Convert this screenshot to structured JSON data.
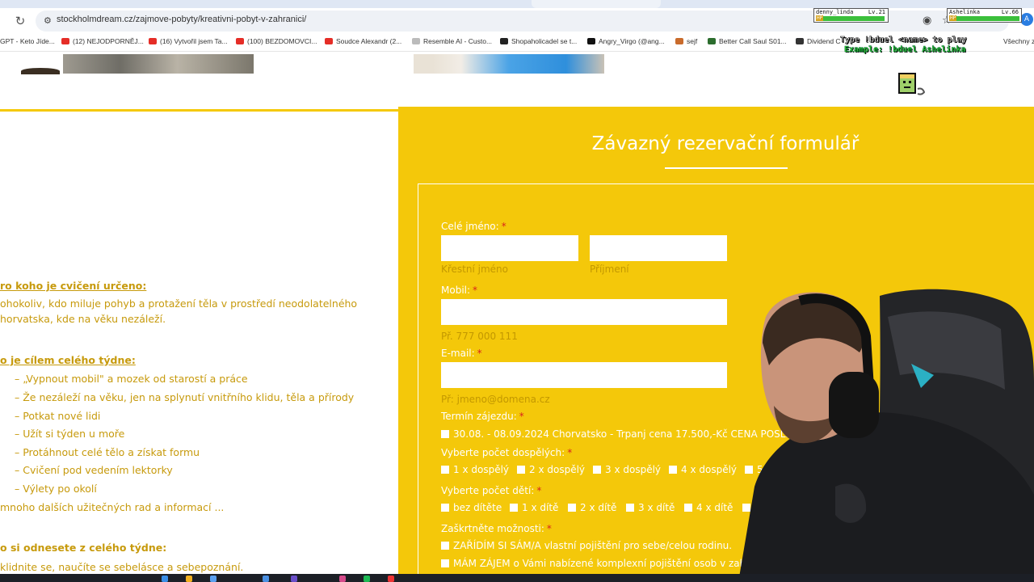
{
  "browser": {
    "url": "stockholmdream.cz/zajmove-pobyty/kreativni-pobyt-v-zahranici/",
    "avatar_letter": "A",
    "bookmarks": [
      "GPT - Keto Jíde...",
      "(12) NEJODPORNĚJ...",
      "(16) Vytvořil jsem Ta...",
      "(100) BEZDOMOVCI...",
      "Soudce Alexandr (2...",
      "Resemble AI - Custo...",
      "Shopaholicadel se t...",
      "Angry_Virgo (@ang...",
      "sejf",
      "Better Call Saul S01...",
      "Dividend C",
      "Všechny z"
    ]
  },
  "overlay": {
    "player1_name": "denny_linda",
    "player1_level": "Lv.21",
    "player1_hp": 0.95,
    "player2_name": "Ashelinka",
    "player2_level": "Lv.66",
    "player2_hp": 0.97,
    "hp_label": "HP",
    "duel_instruction": "Type !bduel <name> to play",
    "duel_example": "Example: !bduel Ashelinka"
  },
  "left": {
    "h1": "ro koho je cvičení určeno:",
    "p1a": "ohokoliv, kdo miluje pohyb a protažení těla v prostředí neodolatelného",
    "p1b": "horvatska, kde na věku nezáleží.",
    "h2": "o je cílem celého týdne:",
    "items": [
      "– „Vypnout mobil\" a mozek od starostí a práce",
      "– Že nezáleží na věku, jen na splynutí vnitřního klidu, těla a přírody",
      "– Potkat nové lidi",
      "– Užít si týden u moře",
      "– Protáhnout celé tělo a získat formu",
      "– Cvičení pod vedením lektorky",
      "– Výlety po okolí"
    ],
    "more": "mnoho dalších užitečných rad a informací ...",
    "h3": "o si odnesete z celého týdne:",
    "p3": "klidnite se, naučíte se sebelásce a sebepoznání."
  },
  "form": {
    "title": "Závazný rezervační formulář",
    "name_label": "Celé jméno:",
    "required_mark": "*",
    "first_hint": "Křestní jméno",
    "last_hint": "Příjmení",
    "mobile_label": "Mobil:",
    "mobile_hint": "Př. 777 000 111",
    "email_label": "E-mail:",
    "email_hint": "Př: jmeno@domena.cz",
    "term_label": "Termín zájezdu:",
    "term_option": "30.08. - 08.09.2024 Chorvatsko - Trpanj cena 17.500,-Kč CENA POSLE",
    "adults_label": "Vyberte počet dospělých:",
    "adults": [
      "1 x dospělý",
      "2 x dospělý",
      "3 x dospělý",
      "4 x dospělý",
      "5 x"
    ],
    "kids_label": "Vyberte počet dětí:",
    "kids": [
      "bez dítěte",
      "1 x dítě",
      "2 x dítě",
      "3 x dítě",
      "4 x dítě",
      "5"
    ],
    "options_label": "Zaškrtněte možnosti:",
    "option1": "ZAŘÍDÍM SI SÁM/A vlastní pojištění pro sebe/celou rodinu.",
    "option2": "MÁM ZÁJEM o Vámi nabízené komplexní pojištění osob v zahra"
  }
}
